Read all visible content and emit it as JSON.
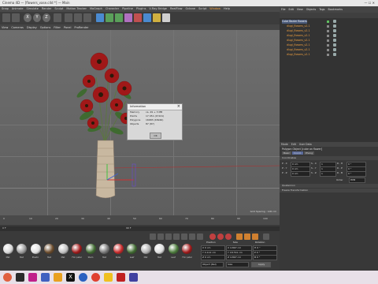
{
  "window": {
    "title": "Cinema 4D — [flowers_vase.c4d *] — Main"
  },
  "menubar": {
    "items": [
      "Snap",
      "Animate",
      "Simulate",
      "Render",
      "Sculpt",
      "Motion Tracker",
      "MoGraph",
      "Character",
      "Pipeline",
      "Plugins",
      "V-Ray Bridge",
      "RealFlow",
      "Octane",
      "Script",
      "Window",
      "Help"
    ],
    "highlight": [
      "Window"
    ]
  },
  "toolbar": {
    "x_label": "X",
    "y_label": "Y",
    "z_label": "Z"
  },
  "viewport_menu": [
    "View",
    "Cameras",
    "Display",
    "Options",
    "Filter",
    "Panel",
    "ProRender"
  ],
  "viewport": {
    "grid_spacing": "Grid Spacing : 100 cm"
  },
  "info_popup": {
    "title": "Information",
    "rows": [
      {
        "k": "Memory",
        "v": "ca. 49 + 3 MB"
      },
      {
        "k": "Points",
        "v": "17 451 (47221)"
      },
      {
        "k": "Polygons",
        "v": "16683 (46946)"
      },
      {
        "k": "Objects",
        "v": "87 (87)"
      }
    ],
    "ok": "OK"
  },
  "right_tabs": [
    "File",
    "Edit",
    "View",
    "Objects",
    "Tags",
    "Bookmarks"
  ],
  "objects": [
    "Cube Bezier flowers",
    "dlugi_flowers_v2.1",
    "dlugi_flowers_v2.1",
    "dlugi_flowers_v2.1",
    "dlugi_flowers_v2.1",
    "dlugi_flowers_v2.1",
    "dlugi_flowers_v2.1",
    "dlugi_flowers_v2.1"
  ],
  "attributes": {
    "menu": [
      "Mode",
      "Edit",
      "User Data"
    ],
    "header": "Polygon Object [cube on flower]",
    "tabs": [
      "Basic",
      "Coord.",
      "Phong"
    ],
    "section": "Coordinates",
    "rows": [
      {
        "p": "P . X",
        "pv": "0 cm",
        "s": "S . X",
        "sv": "1",
        "r": "R . H",
        "rv": "0 °"
      },
      {
        "p": "P . Y",
        "pv": "0 cm",
        "s": "S . Y",
        "sv": "1",
        "r": "R . P",
        "rv": "0 °"
      },
      {
        "p": "P . Z",
        "pv": "0 cm",
        "s": "S . Z",
        "sv": "1",
        "r": "R . B",
        "rv": "0 °"
      }
    ],
    "order_label": "Order",
    "order_value": "HPB",
    "quaternion": "Quaternion",
    "freeze": "Freeze Transformation"
  },
  "timeline": {
    "ticks": [
      "0",
      "10",
      "20",
      "30",
      "40",
      "50",
      "60",
      "70",
      "80",
      "90",
      "100"
    ],
    "frame_start": "0 F",
    "frame_end": "90 F"
  },
  "materials": [
    "Mat",
    "Mat",
    "Plastic",
    "Mat",
    "Mat",
    "Flor petal",
    "Stem",
    "Mat",
    "Petal",
    "Leaf",
    "Mat",
    "Mat",
    "Leaf",
    "Flor petal"
  ],
  "coordinates": {
    "headers": [
      "Position",
      "Size",
      "Rotation"
    ],
    "rows": [
      {
        "a": "X  0 cm",
        "b": "X  4.897 cm",
        "c": "H  0 °"
      },
      {
        "a": "Y  4.112 cm",
        "b": "Y  18.791 cm",
        "c": "P  0 °"
      },
      {
        "a": "Z  0 cm",
        "b": "Z  4.897 cm",
        "c": "B  0 °"
      }
    ],
    "mode": "Object (Rel)",
    "size_mode": "Size",
    "apply": "Apply"
  }
}
